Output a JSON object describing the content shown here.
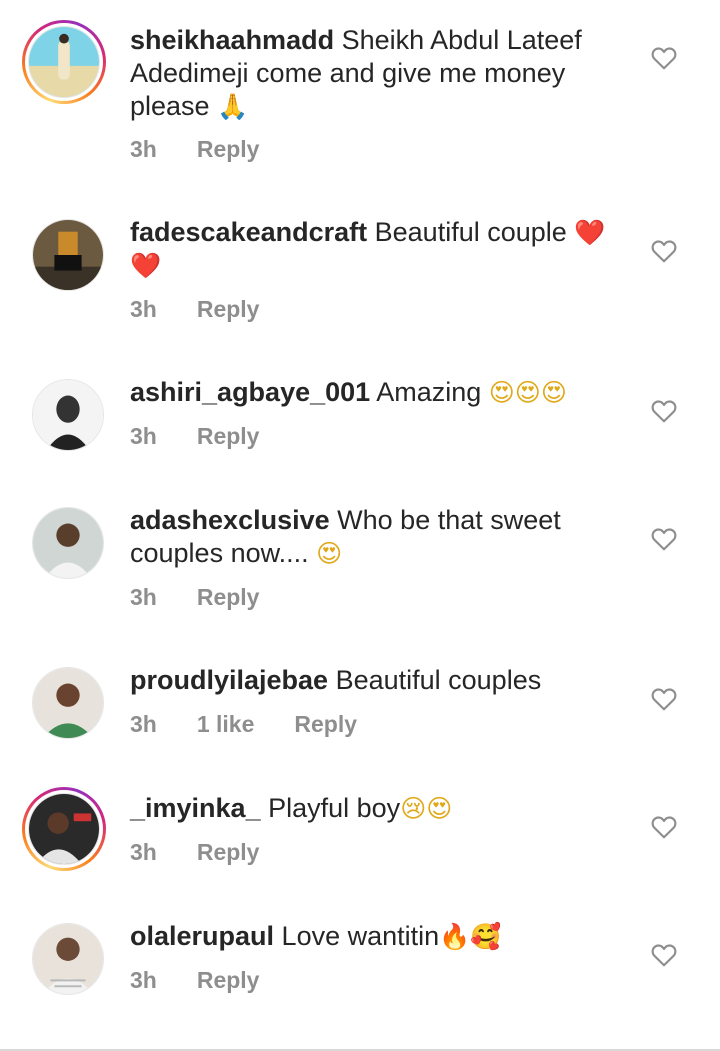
{
  "comments": [
    {
      "username": "sheikhaahmadd",
      "text": "Sheikh Abdul Lateef Adedimeji come and give me money please",
      "emoji": "🙏",
      "time": "3h",
      "likes": "",
      "reply_label": "Reply",
      "has_story": true
    },
    {
      "username": "fadescakeandcraft",
      "text": "Beautiful couple",
      "emoji": "❤️ ❤️",
      "time": "3h",
      "likes": "",
      "reply_label": "Reply",
      "has_story": false
    },
    {
      "username": "ashiri_agbaye_001",
      "text": "Amazing",
      "emoji": "😍😍😍",
      "time": "3h",
      "likes": "",
      "reply_label": "Reply",
      "has_story": false
    },
    {
      "username": "adashexclusive",
      "text": "Who be that sweet couples now....",
      "emoji": "😍",
      "time": "3h",
      "likes": "",
      "reply_label": "Reply",
      "has_story": false
    },
    {
      "username": "proudlyilajebae",
      "text": "Beautiful couples",
      "emoji": "",
      "time": "3h",
      "likes": "1 like",
      "reply_label": "Reply",
      "has_story": false
    },
    {
      "username": "_imyinka_",
      "text": "Playful boy",
      "emoji": "😢😍",
      "time": "3h",
      "likes": "",
      "reply_label": "Reply",
      "has_story": true
    },
    {
      "username": "olalerupaul",
      "text": "Love wantitin",
      "emoji": "🔥🥰",
      "time": "3h",
      "likes": "",
      "reply_label": "Reply",
      "has_story": false
    }
  ],
  "icons": {
    "like": "heart-outline-icon"
  },
  "colors": {
    "text": "#262626",
    "meta": "#8e8e8e",
    "heart_emoji": "#e0222b"
  }
}
